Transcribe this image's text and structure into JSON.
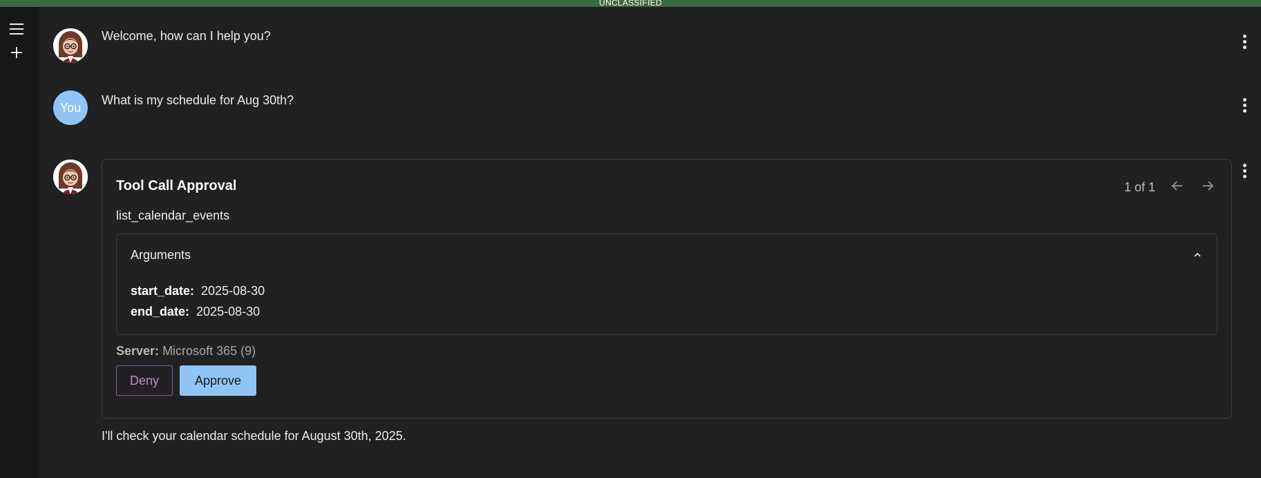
{
  "banner": {
    "text": "UNCLASSIFIED"
  },
  "sidebar": {
    "menu_icon": "menu-icon",
    "new_chat_icon": "plus-icon"
  },
  "messages": [
    {
      "role": "assistant",
      "avatar": "assistant-avatar",
      "text": "Welcome, how can I help you?"
    },
    {
      "role": "user",
      "avatar_label": "You",
      "text": "What is my schedule for Aug 30th?"
    },
    {
      "role": "assistant",
      "avatar": "assistant-avatar",
      "text": "I'll check your calendar schedule for August 30th, 2025."
    }
  ],
  "tool_approval": {
    "title": "Tool Call Approval",
    "pager": "1 of 1",
    "tool_name": "list_calendar_events",
    "arguments_title": "Arguments",
    "arguments": [
      {
        "key": "start_date:",
        "value": "2025-08-30"
      },
      {
        "key": "end_date:",
        "value": "2025-08-30"
      }
    ],
    "server_label": "Server:",
    "server_value": "Microsoft 365 (9)",
    "deny_label": "Deny",
    "approve_label": "Approve"
  },
  "colors": {
    "background": "#212121",
    "sidebar": "#171717",
    "banner": "#3a6b3b",
    "accent": "#8ec5f6",
    "deny": "#c08ad6",
    "border": "#3d3d3d"
  }
}
